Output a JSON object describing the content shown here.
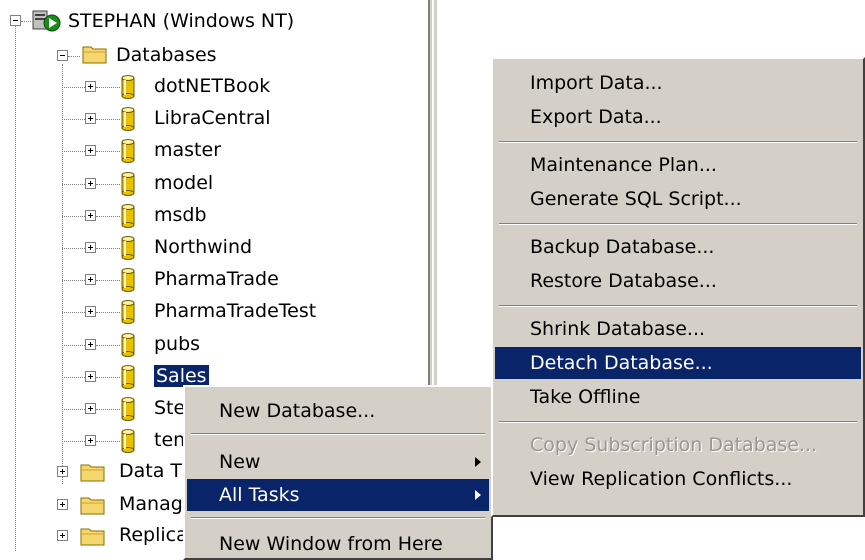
{
  "tree": {
    "server": "STEPHAN (Windows NT)",
    "databases_label": "Databases",
    "databases": [
      "dotNETBook",
      "LibraCentral",
      "master",
      "model",
      "msdb",
      "Northwind",
      "PharmaTrade",
      "PharmaTradeTest",
      "pubs",
      "Sales",
      "Ste",
      "ten"
    ],
    "selected": "Sales",
    "bottom_folders": [
      "Data Ti",
      "Manag",
      "Replica"
    ]
  },
  "context_menu": {
    "items": [
      "New Database...",
      "New",
      "All Tasks",
      "New Window from Here"
    ],
    "highlighted": "All Tasks"
  },
  "submenu": {
    "groups": [
      [
        "Import Data...",
        "Export Data..."
      ],
      [
        "Maintenance Plan...",
        "Generate SQL Script..."
      ],
      [
        "Backup Database...",
        "Restore Database..."
      ],
      [
        "Shrink Database...",
        "Detach Database...",
        "Take Offline"
      ],
      [
        "Copy Subscription Database...",
        "View Replication Conflicts..."
      ]
    ],
    "highlighted": "Detach Database...",
    "disabled": "Copy Subscription Database..."
  },
  "colors": {
    "selection": "#0a246a",
    "menu_bg": "#d4d0c8",
    "folder": "#f5d76e",
    "cylinder": "#e8c200"
  }
}
